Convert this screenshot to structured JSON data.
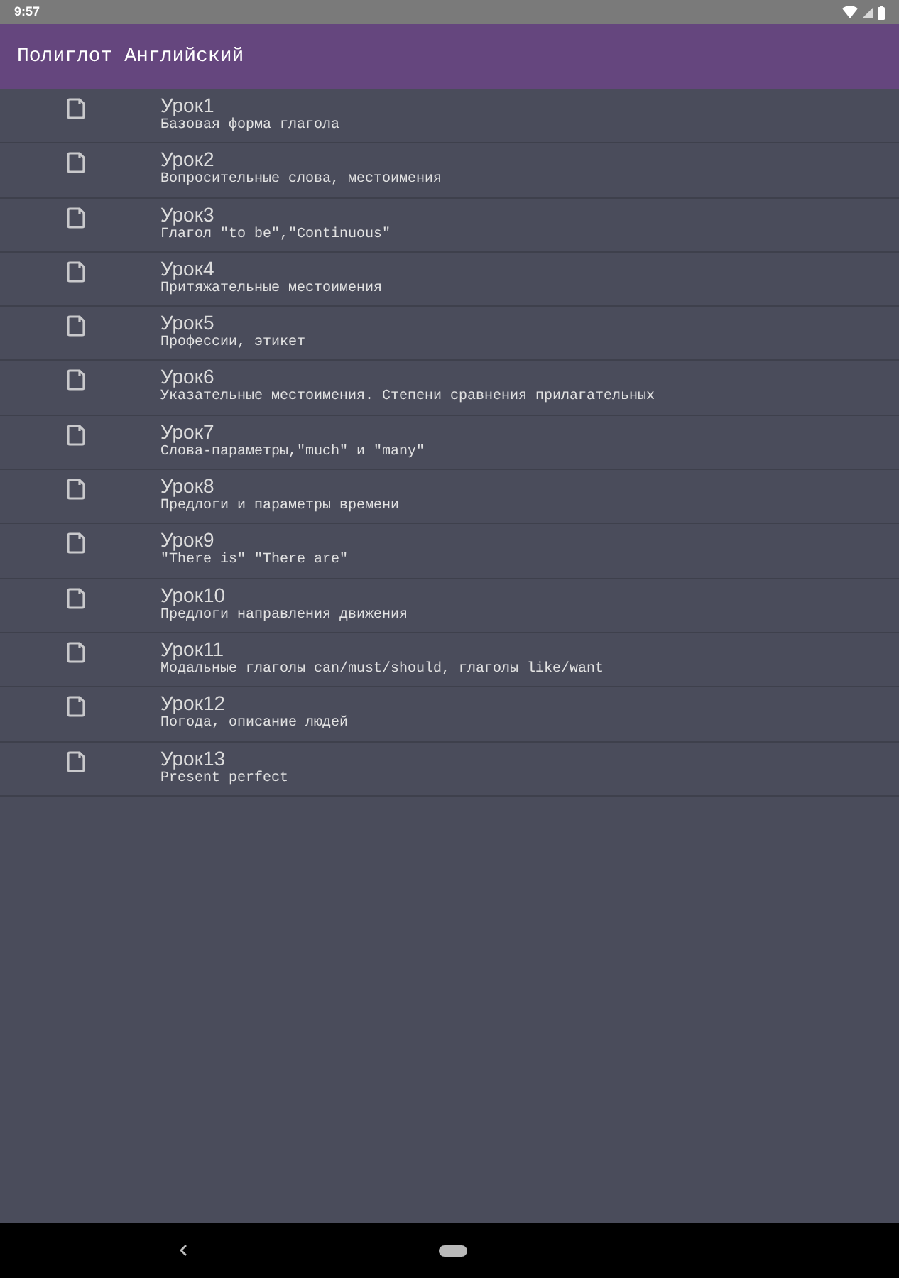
{
  "status_bar": {
    "time": "9:57"
  },
  "app_bar": {
    "title": "Полиглот Английский"
  },
  "lessons": [
    {
      "title": "Урок1",
      "subtitle": "Базовая форма глагола"
    },
    {
      "title": "Урок2",
      "subtitle": "Вопросительные слова, местоимения"
    },
    {
      "title": "Урок3",
      "subtitle": "Глагол \"to be\",\"Continuous\""
    },
    {
      "title": "Урок4",
      "subtitle": "Притяжательные местоимения"
    },
    {
      "title": "Урок5",
      "subtitle": "Профессии, этикет"
    },
    {
      "title": "Урок6",
      "subtitle": "Указательные местоимения. Степени сравнения прилагательных"
    },
    {
      "title": "Урок7",
      "subtitle": "Слова-параметры,\"much\" и \"many\""
    },
    {
      "title": "Урок8",
      "subtitle": "Предлоги и параметры времени"
    },
    {
      "title": "Урок9",
      "subtitle": "\"There is\" \"There are\""
    },
    {
      "title": "Урок10",
      "subtitle": "Предлоги направления движения"
    },
    {
      "title": "Урок11",
      "subtitle": "Модальные глаголы can/must/should, глаголы like/want"
    },
    {
      "title": "Урок12",
      "subtitle": "Погода, описание людей"
    },
    {
      "title": "Урок13",
      "subtitle": "Present perfect"
    }
  ]
}
